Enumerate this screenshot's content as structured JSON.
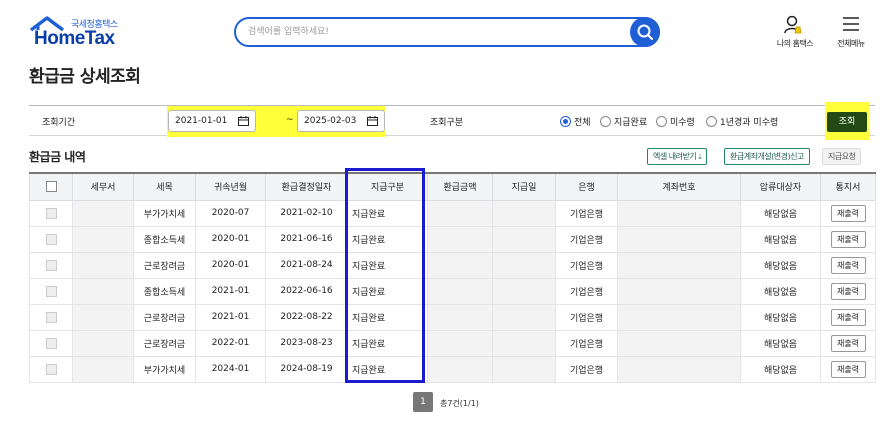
{
  "header": {
    "logo_sub": "국세청홈택스",
    "logo_main": "HomeTax",
    "search_placeholder": "검색어를 입력하세요!",
    "my_home": "나의 홈택스",
    "all_menu": "전체메뉴"
  },
  "page_title": "환급금 상세조회",
  "filter": {
    "period_label": "조회기간",
    "date_from": "2021-01-01",
    "date_to": "2025-02-03",
    "dash": "~",
    "type_label": "조회구분",
    "radios": [
      {
        "label": "전체",
        "checked": true
      },
      {
        "label": "지급완료",
        "checked": false
      },
      {
        "label": "미수령",
        "checked": false
      },
      {
        "label": "1년경과 미수령",
        "checked": false
      }
    ],
    "query_button": "조회",
    "highlight_color": "#ffff3a"
  },
  "section": {
    "title": "환급금 내역",
    "excel_button": "엑셀 내려받기",
    "account_button": "환급계좌개설(변경)신고",
    "request_button": "지급요청"
  },
  "table": {
    "headers": [
      "",
      "세무서",
      "세목",
      "귀속년월",
      "환급결정일자",
      "지급구분",
      "환급금액",
      "지급일",
      "은행",
      "계좌번호",
      "압류대상자",
      "통지서"
    ],
    "rows": [
      {
        "tax": "부가가치세",
        "period": "2020-07",
        "decision": "2021-02-10",
        "status": "지급완료",
        "bank": "기업은행",
        "seizure": "해당없음",
        "notice": "재출력"
      },
      {
        "tax": "종합소득세",
        "period": "2020-01",
        "decision": "2021-06-16",
        "status": "지급완료",
        "bank": "기업은행",
        "seizure": "해당없음",
        "notice": "재출력"
      },
      {
        "tax": "근로장려금",
        "period": "2020-01",
        "decision": "2021-08-24",
        "status": "지급완료",
        "bank": "기업은행",
        "seizure": "해당없음",
        "notice": "재출력"
      },
      {
        "tax": "종합소득세",
        "period": "2021-01",
        "decision": "2022-06-16",
        "status": "지급완료",
        "bank": "기업은행",
        "seizure": "해당없음",
        "notice": "재출력"
      },
      {
        "tax": "근로장려금",
        "period": "2021-01",
        "decision": "2022-08-22",
        "status": "지급완료",
        "bank": "기업은행",
        "seizure": "해당없음",
        "notice": "재출력"
      },
      {
        "tax": "근로장려금",
        "period": "2022-01",
        "decision": "2023-08-23",
        "status": "지급완료",
        "bank": "기업은행",
        "seizure": "해당없음",
        "notice": "재출력"
      },
      {
        "tax": "부가가치세",
        "period": "2024-01",
        "decision": "2024-08-19",
        "status": "지급완료",
        "bank": "기업은행",
        "seizure": "해당없음",
        "notice": "재출력"
      }
    ],
    "highlight_border_color": "#1b1bd0"
  },
  "pagination": {
    "current": "1",
    "total_text": "총7건(1/1)"
  }
}
